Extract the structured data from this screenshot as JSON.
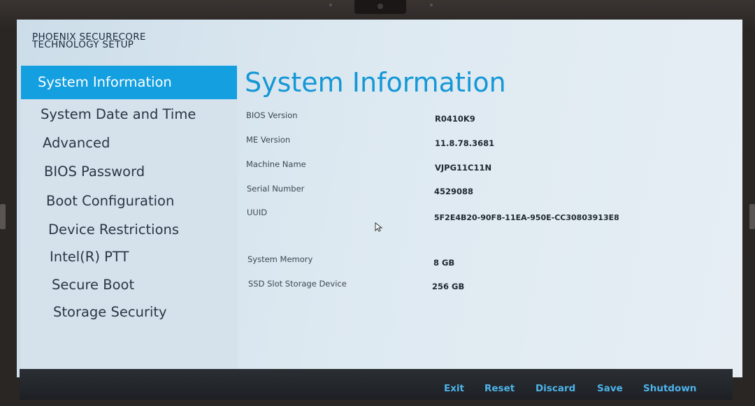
{
  "header": {
    "brand_line1": "PHOENIX SECURECORE",
    "brand_line2": "TECHNOLOGY SETUP"
  },
  "sidebar": {
    "items": [
      {
        "label": "System Information",
        "active": true
      },
      {
        "label": "System Date and Time",
        "active": false
      },
      {
        "label": "Advanced",
        "active": false
      },
      {
        "label": "BIOS Password",
        "active": false
      },
      {
        "label": "Boot Configuration",
        "active": false
      },
      {
        "label": "Device Restrictions",
        "active": false
      },
      {
        "label": "Intel(R) PTT",
        "active": false
      },
      {
        "label": "Secure Boot",
        "active": false
      },
      {
        "label": "Storage Security",
        "active": false
      }
    ]
  },
  "main": {
    "title": "System Information",
    "rows": [
      {
        "label": "BIOS Version",
        "value": "R0410K9"
      },
      {
        "label": "ME Version",
        "value": "11.8.78.3681"
      },
      {
        "label": "Machine Name",
        "value": "VJPG11C11N"
      },
      {
        "label": "Serial Number",
        "value": "4529088"
      },
      {
        "label": "UUID",
        "value": "5F2E4B20-90F8-11EA-950E-CC30803913E8"
      },
      {
        "label": "System Memory",
        "value": "8 GB"
      },
      {
        "label": "SSD Slot Storage Device",
        "value": "256 GB"
      }
    ]
  },
  "footer": {
    "exit_label": "Exit",
    "reset_label": "Reset",
    "discard_label": "Discard",
    "save_label": "Save",
    "shutdown_label": "Shutdown"
  },
  "colors": {
    "accent": "#139fe0",
    "title": "#1597d6",
    "footer_text": "#4db3ea"
  },
  "icons": {
    "pointer": "mouse-pointer-icon"
  }
}
